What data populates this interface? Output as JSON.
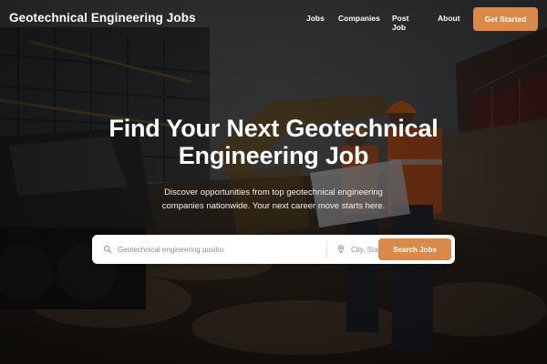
{
  "nav": {
    "brand": "Geotechnical Engineering Jobs",
    "links": [
      "Jobs",
      "Companies",
      "Post Job",
      "About"
    ],
    "cta": "Get Started"
  },
  "hero": {
    "title_line1": "Find Your Next Geotechnical",
    "title_line2": "Engineering Job",
    "subtitle_line1": "Discover opportunities from top geotechnical engineering",
    "subtitle_line2": "companies nationwide. Your next career move starts here."
  },
  "search": {
    "keyword_placeholder": "Geotechnical engineering positio",
    "location_placeholder": "City, State",
    "button_label": "Search Jobs"
  },
  "colors": {
    "accent": "#d9894a",
    "overlay": "#1a1a1a",
    "text": "#ffffff"
  },
  "icons": {
    "keyword_icon": "search-icon",
    "location_icon": "location-pin-icon"
  }
}
